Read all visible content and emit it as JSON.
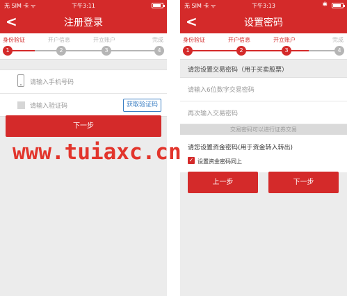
{
  "left": {
    "status": {
      "carrier": "无 SIM 卡 ᯤ",
      "time": "下午3:11"
    },
    "nav": {
      "back": "<",
      "title": "注册登录"
    },
    "steps": [
      "身份验证",
      "开户信息",
      "开立账户",
      "完成"
    ],
    "step_numbers": [
      "1",
      "2",
      "3",
      "4"
    ],
    "active_step": 1,
    "form": {
      "phone_placeholder": "请输入手机号码",
      "code_placeholder": "请输入验证码",
      "get_code": "获取验证码"
    },
    "next": "下一步"
  },
  "right": {
    "status": {
      "carrier": "无 SIM 卡 ᯤ",
      "time": "下午3:13",
      "bt": "✱"
    },
    "nav": {
      "back": "<",
      "title": "设置密码"
    },
    "steps": [
      "身份验证",
      "开户信息",
      "开立账户",
      "完成"
    ],
    "step_numbers": [
      "1",
      "2",
      "3",
      "4"
    ],
    "active_step": 3,
    "trade_section": "请您设置交易密码（用于买卖股票）",
    "trade_pwd_placeholder": "请输入6位数字交易密码",
    "trade_pwd_again": "再次输入交易密码",
    "hint": "交易密码可以进行证券交易",
    "fund_title": "请您设置资金密码(用于资金转入转出)",
    "same_as_trade": "设置资金密码同上",
    "prev": "上一步",
    "next": "下一步"
  },
  "watermark": "www.tuiaxc.cn",
  "colors": {
    "primary": "#d42a2a",
    "link": "#3b7fc4",
    "background": "#ececec"
  }
}
